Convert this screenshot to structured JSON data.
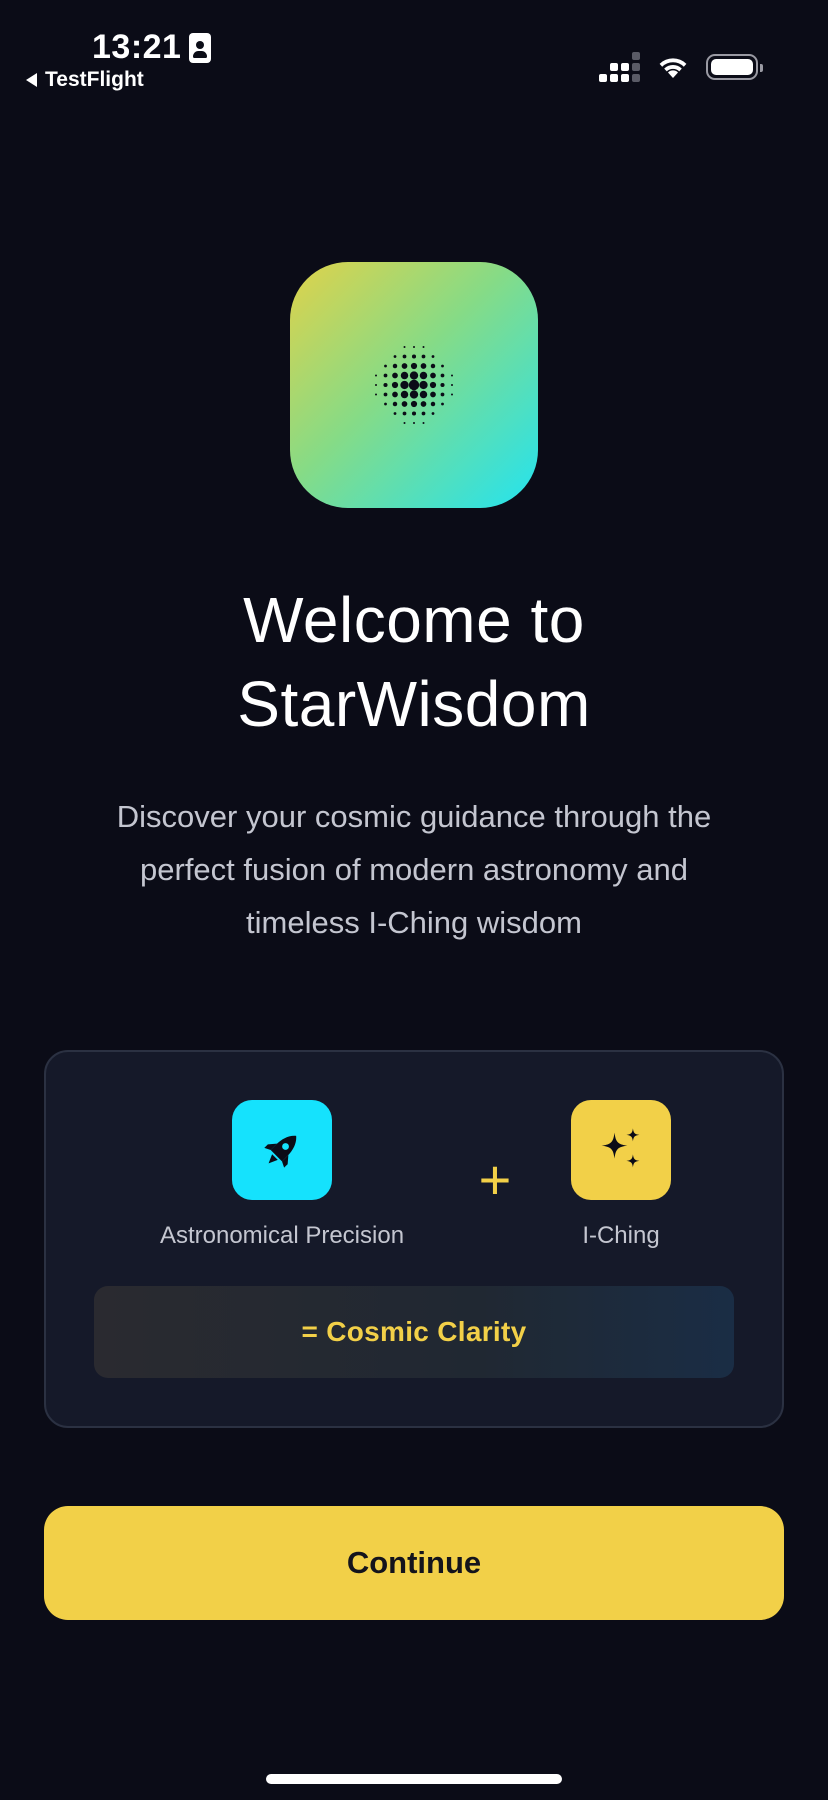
{
  "status_bar": {
    "time": "13:21",
    "back_label": "TestFlight"
  },
  "app_icon": {
    "icon": "dotted-sun-icon",
    "gradient": [
      "#e0d24a",
      "#86db86",
      "#23e3f0"
    ]
  },
  "welcome": {
    "title_line1": "Welcome to",
    "title_line2": "StarWisdom",
    "subtitle_line1": "Discover your cosmic guidance through the",
    "subtitle_line2": "perfect fusion of modern astronomy and",
    "subtitle_line3": "timeless I-Ching wisdom"
  },
  "card": {
    "astronomy": {
      "icon": "rocket-icon",
      "label": "Astronomical Precision",
      "color": "#15e2fd"
    },
    "plus": "+",
    "iching": {
      "icon": "sparkles-icon",
      "label": "I-Ching",
      "color": "#f2d048"
    },
    "result": "= Cosmic Clarity"
  },
  "actions": {
    "continue_label": "Continue"
  },
  "colors": {
    "background": "#0b0c17",
    "accent": "#f2d048",
    "card": "#151929"
  }
}
